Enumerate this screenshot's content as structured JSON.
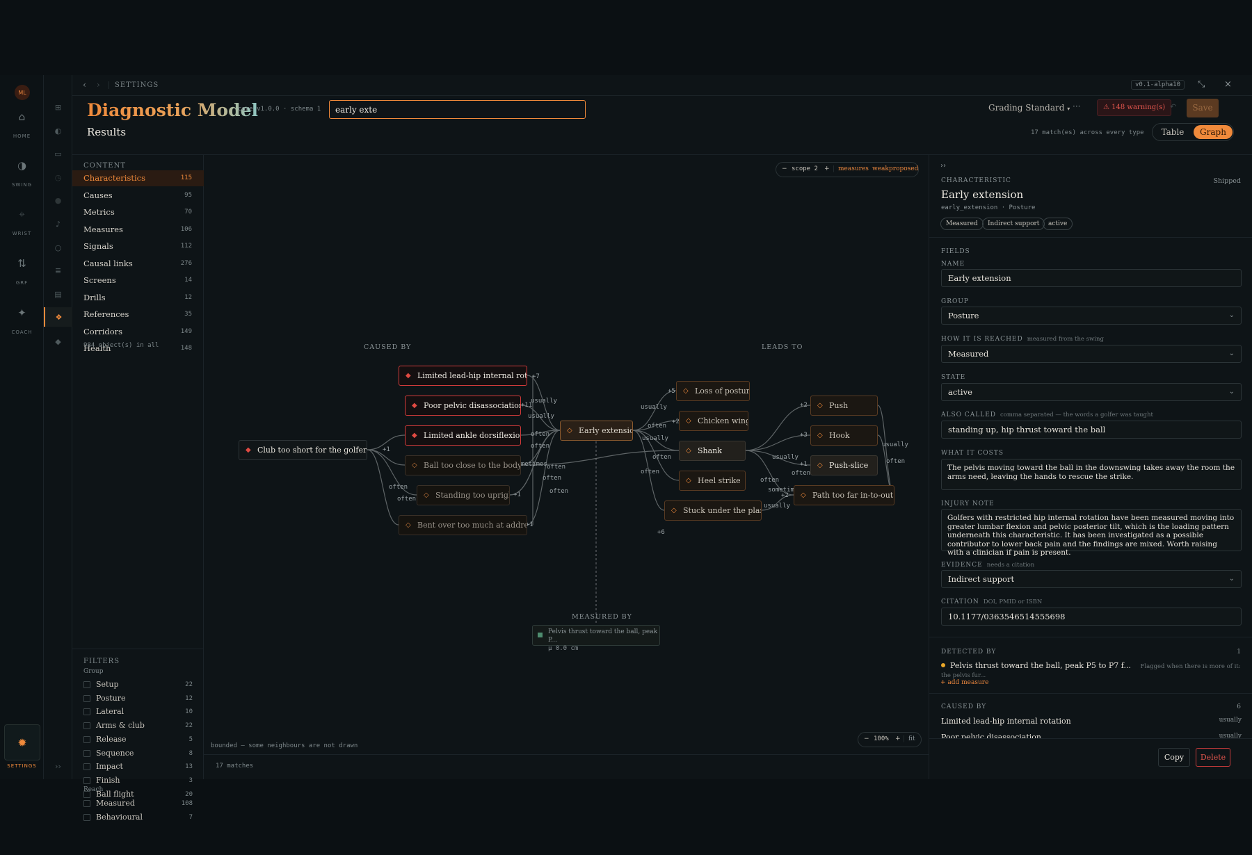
{
  "rail": {
    "avatar": "ML",
    "items": [
      {
        "label": "HOME",
        "icon": "home-icon"
      },
      {
        "label": "SWING",
        "icon": "half-circle-icon"
      },
      {
        "label": "WRIST",
        "icon": "crosshair-icon"
      },
      {
        "label": "GRF",
        "icon": "arrows-updown-icon"
      },
      {
        "label": "COACH",
        "icon": "sparkle-icon"
      }
    ],
    "settings_label": "SETTINGS"
  },
  "topbar": {
    "breadcrumb": "SETTINGS",
    "version": "v0.1-alpha10"
  },
  "header": {
    "title": "Diagnostic Model",
    "core_version": "core v1.0.0 · schema 1",
    "search_value": "early exte",
    "standard": "Grading Standard",
    "more": "···",
    "warnings": "⚠ 148 warning(s)",
    "save_label": "Save",
    "results_title": "Results",
    "match_info": "17 match(es) across every type",
    "view_table": "Table",
    "view_graph": "Graph"
  },
  "content": {
    "label": "CONTENT",
    "items": [
      {
        "name": "Characteristics",
        "count": "115"
      },
      {
        "name": "Causes",
        "count": "95"
      },
      {
        "name": "Metrics",
        "count": "70"
      },
      {
        "name": "Measures",
        "count": "106"
      },
      {
        "name": "Signals",
        "count": "112"
      },
      {
        "name": "Causal links",
        "count": "276"
      },
      {
        "name": "Screens",
        "count": "14"
      },
      {
        "name": "Drills",
        "count": "12"
      },
      {
        "name": "References",
        "count": "35"
      },
      {
        "name": "Corridors",
        "count": "149"
      },
      {
        "name": "Health",
        "count": "148"
      }
    ],
    "total": "984 object(s) in all"
  },
  "filters": {
    "label": "FILTERS",
    "group_label": "Group",
    "groups": [
      {
        "name": "Setup",
        "count": "22"
      },
      {
        "name": "Posture",
        "count": "12"
      },
      {
        "name": "Lateral",
        "count": "10"
      },
      {
        "name": "Arms & club",
        "count": "22"
      },
      {
        "name": "Release",
        "count": "5"
      },
      {
        "name": "Sequence",
        "count": "8"
      },
      {
        "name": "Impact",
        "count": "13"
      },
      {
        "name": "Finish",
        "count": "3"
      },
      {
        "name": "Ball flight",
        "count": "20"
      }
    ],
    "reach_label": "Reach",
    "reach": [
      {
        "name": "Measured",
        "count": "108"
      },
      {
        "name": "Behavioural",
        "count": "7"
      }
    ]
  },
  "graph": {
    "scope": {
      "minus": "−",
      "label": "scope 2",
      "plus": "+",
      "measures": "measures",
      "weak": "weak",
      "proposed": "proposed"
    },
    "caused_by_label": "CAUSED BY",
    "leads_to_label": "LEADS TO",
    "measured_by_label": "MEASURED BY",
    "focus": "Early extension",
    "causes": [
      "Limited lead-hip internal rotation",
      "Poor pelvic disassociation",
      "Limited ankle dorsiflexion",
      "Ball too close to the body",
      "Standing too upright",
      "Bent over too much at address"
    ],
    "root": "Club too short for the golfer",
    "leads": [
      "Loss of posture",
      "Chicken wing",
      "Shank",
      "Heel strike",
      "Stuck under the plane"
    ],
    "far_leads": [
      "Push",
      "Hook",
      "Push-slice",
      "Path too far in-to-out"
    ],
    "measure_name": "Pelvis thrust toward the ball, peak P...",
    "measure_value": "µ 0.0 cm",
    "edge_labels": {
      "usually": "usually",
      "often": "often",
      "sometimes": "sometimes",
      "sometimes_short": "sometimes",
      "p1": "+1",
      "p2": "+2",
      "p3": "+3",
      "p5": "+5",
      "p6": "+6",
      "p7": "+7",
      "p11": "+11"
    },
    "bounded_note": "bounded — some neighbours are not drawn",
    "zoom": {
      "minus": "−",
      "value": "100%",
      "plus": "+",
      "fit": "fit"
    },
    "footer": "17 matches"
  },
  "detail": {
    "collapse": "››",
    "kind": "CHARACTERISTIC",
    "status": "Shipped",
    "name": "Early extension",
    "id_line": "early_extension · Posture",
    "tags": [
      "Measured",
      "Indirect support",
      "active"
    ],
    "fields_label": "FIELDS",
    "name_label": "NAME",
    "name_value": "Early extension",
    "group_label": "GROUP",
    "group_value": "Posture",
    "reached_label": "HOW IT IS REACHED",
    "reached_hint": "measured from the swing",
    "reached_value": "Measured",
    "state_label": "STATE",
    "state_value": "active",
    "also_label": "ALSO CALLED",
    "also_hint": "comma separated — the words a golfer was taught",
    "also_value": "standing up, hip thrust toward the ball",
    "cost_label": "WHAT IT COSTS",
    "cost_value": "The pelvis moving toward the ball in the downswing takes away the room the arms need, leaving the hands to rescue the strike.",
    "injury_label": "INJURY NOTE",
    "injury_value": "Golfers with restricted hip internal rotation have been measured moving into greater lumbar flexion and pelvic posterior tilt, which is the loading pattern underneath this characteristic. It has been investigated as a possible contributor to lower back pain and the findings are mixed. Worth raising with a clinician if pain is present.",
    "evidence_label": "EVIDENCE",
    "evidence_hint": "needs a citation",
    "evidence_value": "Indirect support",
    "citation_label": "CITATION",
    "citation_hint": "DOI, PMID or ISBN",
    "citation_value": "10.1177/0363546514555698",
    "detected_label": "DETECTED BY",
    "detected_count": "1",
    "detected_name": "Pelvis thrust toward the ball, peak P5 to P7 f...",
    "detected_note": "Flagged when there is more of it: the pelvis fur...",
    "add_measure": "+ add measure",
    "caused_label": "CAUSED BY",
    "caused_count": "6",
    "caused_rows": [
      {
        "name": "Limited lead-hip internal rotation",
        "freq": "usually"
      },
      {
        "name": "Poor pelvic disassociation",
        "freq": "usually"
      }
    ],
    "copy": "Copy",
    "delete": "Delete"
  }
}
